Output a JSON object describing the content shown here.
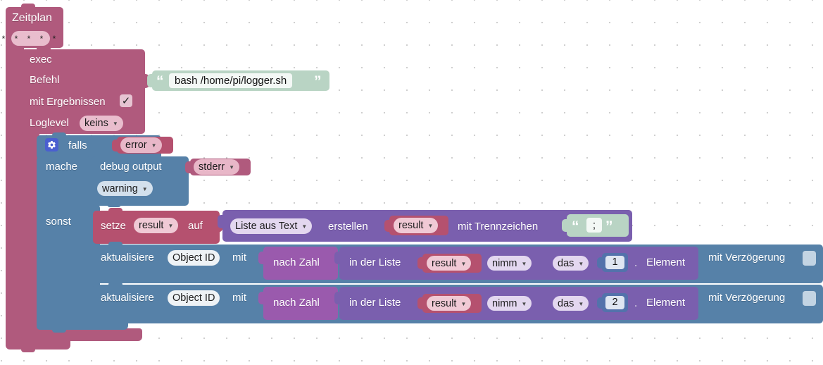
{
  "app": {
    "name": "blockly-script-editor",
    "language": "de"
  },
  "workspace": {
    "background": "#ffffff",
    "grid_dot_color": "#cfcfcf",
    "grid_spacing": 32
  },
  "colors": {
    "exec_block": "#b05a7d",
    "control_block": "#5681a8",
    "variable_block": "#b5516f",
    "list_block": "#7a5fae",
    "math_block": "#9a5aad",
    "text_block": "#b9d4c4",
    "number_block": "#5372ab",
    "gear_icon": "#4a5fd0"
  },
  "blocks": {
    "schedule": {
      "name": "schedule-block",
      "label": "Zeitplan",
      "cron_value": "* * * * *"
    },
    "exec": {
      "name": "exec-block",
      "title": "exec",
      "command_label": "Befehl",
      "command_value": "bash /home/pi/logger.sh",
      "quote_open": "“",
      "quote_close": "”",
      "with_results_label": "mit Ergebnissen",
      "with_results_checked": true,
      "with_results_glyph": "✓",
      "loglevel_label": "Loglevel",
      "loglevel_value": "keins"
    },
    "if_block": {
      "name": "if-else-block",
      "gear_icon": "gear-icon",
      "if_label": "falls",
      "condition_value": "error",
      "do_label": "mache",
      "else_label": "sonst"
    },
    "debug_output": {
      "name": "debug-output-block",
      "label": "debug output",
      "target_value": "stderr",
      "severity_value": "warning"
    },
    "set_variable": {
      "name": "set-variable-block",
      "set_label": "setze",
      "variable_value": "result",
      "to_label": "auf"
    },
    "list_from_text": {
      "name": "list-from-text-block",
      "mode_value": "Liste aus Text",
      "create_label": "erstellen",
      "source_variable": "result",
      "separator_label": "mit Trennzeichen",
      "separator_value": ";",
      "quote_open": "“",
      "quote_close": "”"
    },
    "update_rows": [
      {
        "name": "update-state-row-1",
        "update_label": "aktualisiere",
        "object_id_value": "Object ID",
        "with_label": "mit",
        "convert_label": "nach Zahl",
        "in_list_label": "in der Liste",
        "list_variable": "result",
        "take_value": "nimm",
        "which_value": "das",
        "index_value": "1",
        "ordinal_suffix": ".",
        "element_label": "Element",
        "delay_label": "mit Verzögerung",
        "delay_checked": false
      },
      {
        "name": "update-state-row-2",
        "update_label": "aktualisiere",
        "object_id_value": "Object ID",
        "with_label": "mit",
        "convert_label": "nach Zahl",
        "in_list_label": "in der Liste",
        "list_variable": "result",
        "take_value": "nimm",
        "which_value": "das",
        "index_value": "2",
        "ordinal_suffix": ".",
        "element_label": "Element",
        "delay_label": "mit Verzögerung",
        "delay_checked": false
      }
    ]
  }
}
